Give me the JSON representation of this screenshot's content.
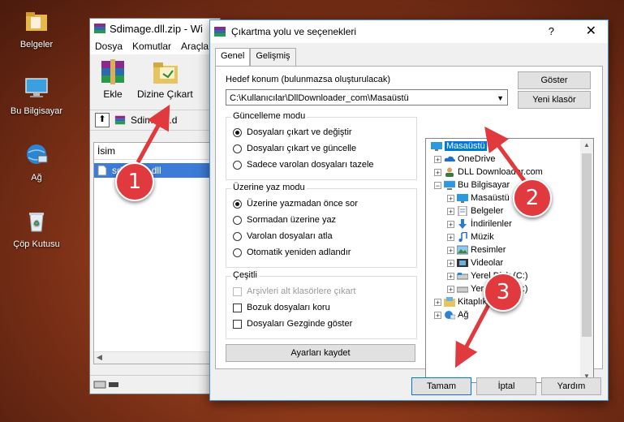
{
  "desktop": {
    "icons": [
      {
        "label": "Belgeler",
        "icon": "folder-icon"
      },
      {
        "label": "Bu Bilgisayar",
        "icon": "computer-icon"
      },
      {
        "label": "Ağ",
        "icon": "network-icon"
      },
      {
        "label": "Çöp Kutusu",
        "icon": "recycle-bin-icon"
      }
    ]
  },
  "winrar": {
    "title": "Sdimage.dll.zip - Wi",
    "menu": [
      "Dosya",
      "Komutlar",
      "Araçla"
    ],
    "toolbar": {
      "add_label": "Ekle",
      "extract_label": "Dizine Çıkart"
    },
    "address": "Sdimage.d",
    "list_header": "İsim",
    "file_name": "sdimage.dll"
  },
  "dialog": {
    "title": "Çıkartma yolu ve seçenekleri",
    "help": "?",
    "close": "✕",
    "tabs": [
      "Genel",
      "Gelişmiş"
    ],
    "dest_label": "Hedef konum (bulunmazsa oluşturulacak)",
    "dest_value": "C:\\Kullanıcılar\\DllDownloader_com\\Masaüstü",
    "show_button": "Göster",
    "new_folder_button": "Yeni klasör",
    "update_mode": {
      "title": "Güncelleme modu",
      "options": [
        "Dosyaları çıkart ve değiştir",
        "Dosyaları çıkart ve güncelle",
        "Sadece varolan dosyaları tazele"
      ],
      "selected": 0
    },
    "overwrite_mode": {
      "title": "Üzerine yaz modu",
      "options": [
        "Üzerine yazmadan önce sor",
        "Sormadan üzerine yaz",
        "Varolan dosyaları atla",
        "Otomatik yeniden adlandır"
      ],
      "selected": 0
    },
    "misc": {
      "title": "Çeşitli",
      "options": [
        {
          "label": "Arşivleri alt klasörlere çıkart",
          "disabled": true
        },
        {
          "label": "Bozuk dosyaları koru",
          "disabled": false
        },
        {
          "label": "Dosyaları Gezginde göster",
          "disabled": false
        }
      ]
    },
    "save_settings_button": "Ayarları kaydet",
    "tree": [
      {
        "label": "Masaüstü",
        "icon": "desktop-icon",
        "selected": true
      },
      {
        "label": "OneDrive",
        "icon": "onedrive-icon",
        "selected": false
      },
      {
        "label": "DLL Downloader.com",
        "icon": "user-icon",
        "selected": false
      },
      {
        "label": "Bu Bilgisayar",
        "icon": "computer-icon",
        "selected": false
      },
      {
        "label": "Masaüstü",
        "icon": "desktop-icon",
        "selected": false
      },
      {
        "label": "Belgeler",
        "icon": "documents-icon",
        "selected": false
      },
      {
        "label": "İndirilenler",
        "icon": "download-icon",
        "selected": false
      },
      {
        "label": "Müzik",
        "icon": "music-icon",
        "selected": false
      },
      {
        "label": "Resimler",
        "icon": "pictures-icon",
        "selected": false
      },
      {
        "label": "Videolar",
        "icon": "videos-icon",
        "selected": false
      },
      {
        "label": "Yerel Disk (C:)",
        "icon": "drive-icon",
        "selected": false
      },
      {
        "label": "Yerel Disk (D:)",
        "icon": "drive-icon",
        "selected": false
      },
      {
        "label": "Kitaplıklar",
        "icon": "libraries-icon",
        "selected": false
      },
      {
        "label": "Ağ",
        "icon": "network-icon",
        "selected": false
      }
    ],
    "ok_button": "Tamam",
    "cancel_button": "İptal",
    "help_button": "Yardım"
  },
  "markers": [
    "1",
    "2",
    "3"
  ],
  "colors": {
    "accent": "#0078d7",
    "marker": "#e0393e",
    "selection": "#3c7bd6"
  }
}
